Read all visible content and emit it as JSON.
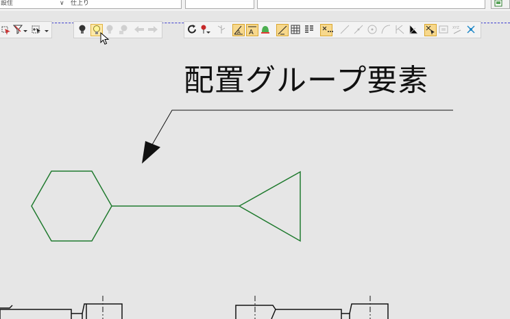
{
  "top_bar": {
    "field_left_text": "設住",
    "field_mid_text": "仕上り"
  },
  "toolbar_view": {
    "buttons": [
      {
        "name": "select-filter-icon"
      },
      {
        "name": "filter-funnel-icon"
      },
      {
        "name": "select-add-icon"
      }
    ]
  },
  "toolbar_bulbs": {
    "buttons": [
      {
        "name": "bulb-dark-icon",
        "state": "normal"
      },
      {
        "name": "bulb-lit-icon",
        "state": "hover"
      },
      {
        "name": "bulb-gray-icon",
        "state": "disabled"
      },
      {
        "name": "bulb-hand-icon",
        "state": "disabled"
      },
      {
        "name": "arrow-left-icon",
        "state": "disabled"
      },
      {
        "name": "arrow-right-icon",
        "state": "disabled"
      }
    ]
  },
  "toolbar_dim": {
    "buttons": [
      {
        "name": "rotate-icon"
      },
      {
        "name": "pin-icon"
      },
      {
        "name": "branch-icon"
      },
      {
        "name": "angle-text-icon",
        "state": "active"
      },
      {
        "name": "text-frame-icon",
        "state": "active"
      },
      {
        "name": "bell-color-icon"
      },
      {
        "name": "diagonal-line-icon",
        "state": "active"
      },
      {
        "name": "matrix-icon"
      },
      {
        "name": "columns-icon"
      },
      {
        "name": "dots-select-icon",
        "state": "active"
      },
      {
        "name": "line-a-icon"
      },
      {
        "name": "line-b-icon"
      },
      {
        "name": "circle-point-icon"
      },
      {
        "name": "curve-icon"
      },
      {
        "name": "k-icon"
      },
      {
        "name": "corner-icon"
      },
      {
        "name": "cross-select-icon",
        "state": "active"
      },
      {
        "name": "frame-icon"
      },
      {
        "name": "xyz-icon"
      },
      {
        "name": "snap-icon"
      }
    ]
  },
  "annotation": {
    "text": "配置グループ要素"
  },
  "drawing": {
    "line_color": "#1f7a2e",
    "leader_color": "#111111"
  }
}
